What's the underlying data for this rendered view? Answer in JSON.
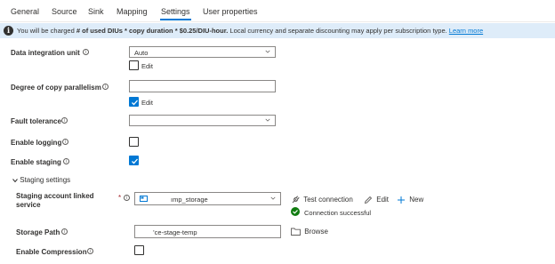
{
  "tabs": [
    {
      "label": "General"
    },
    {
      "label": "Source"
    },
    {
      "label": "Sink"
    },
    {
      "label": "Mapping"
    },
    {
      "label": "Settings",
      "active": true
    },
    {
      "label": "User properties"
    }
  ],
  "banner": {
    "prefix": "You will be charged ",
    "bold": "# of used DIUs * copy duration * $0.25/DIU-hour.",
    "suffix": " Local currency and separate discounting may apply per subscription type.",
    "link": "Learn more"
  },
  "settings": {
    "diu": {
      "label": "Data integration unit",
      "value": "Auto",
      "edit_label": "Edit",
      "edit_checked": false
    },
    "parallelism": {
      "label": "Degree of copy parallelism",
      "value": "",
      "edit_label": "Edit",
      "edit_checked": true
    },
    "fault_tolerance": {
      "label": "Fault tolerance",
      "value": ""
    },
    "logging": {
      "label": "Enable logging",
      "checked": false
    },
    "staging": {
      "label": "Enable staging",
      "checked": true
    }
  },
  "staging_settings": {
    "section_label": "Staging settings",
    "expanded": true,
    "linked_service": {
      "label_line1": "Staging account linked",
      "label_line2": "service",
      "required_mark": "*",
      "value": "ımp_storage",
      "test_connection": "Test connection",
      "edit": "Edit",
      "new": "New",
      "status": "Connection successful"
    },
    "storage_path": {
      "label": "Storage Path",
      "value": "’ce-stage-temp",
      "browse": "Browse"
    },
    "compression": {
      "label": "Enable Compression",
      "checked": false
    }
  },
  "colors": {
    "accent": "#0078d4",
    "banner_bg": "#deecf9",
    "success": "#107c10",
    "required": "#a4262c"
  },
  "icons": [
    "info-icon",
    "chevron-down-icon",
    "checkmark-icon",
    "storage-icon",
    "test-connection-icon",
    "pencil-icon",
    "plus-icon",
    "folder-icon",
    "success-check-icon"
  ]
}
